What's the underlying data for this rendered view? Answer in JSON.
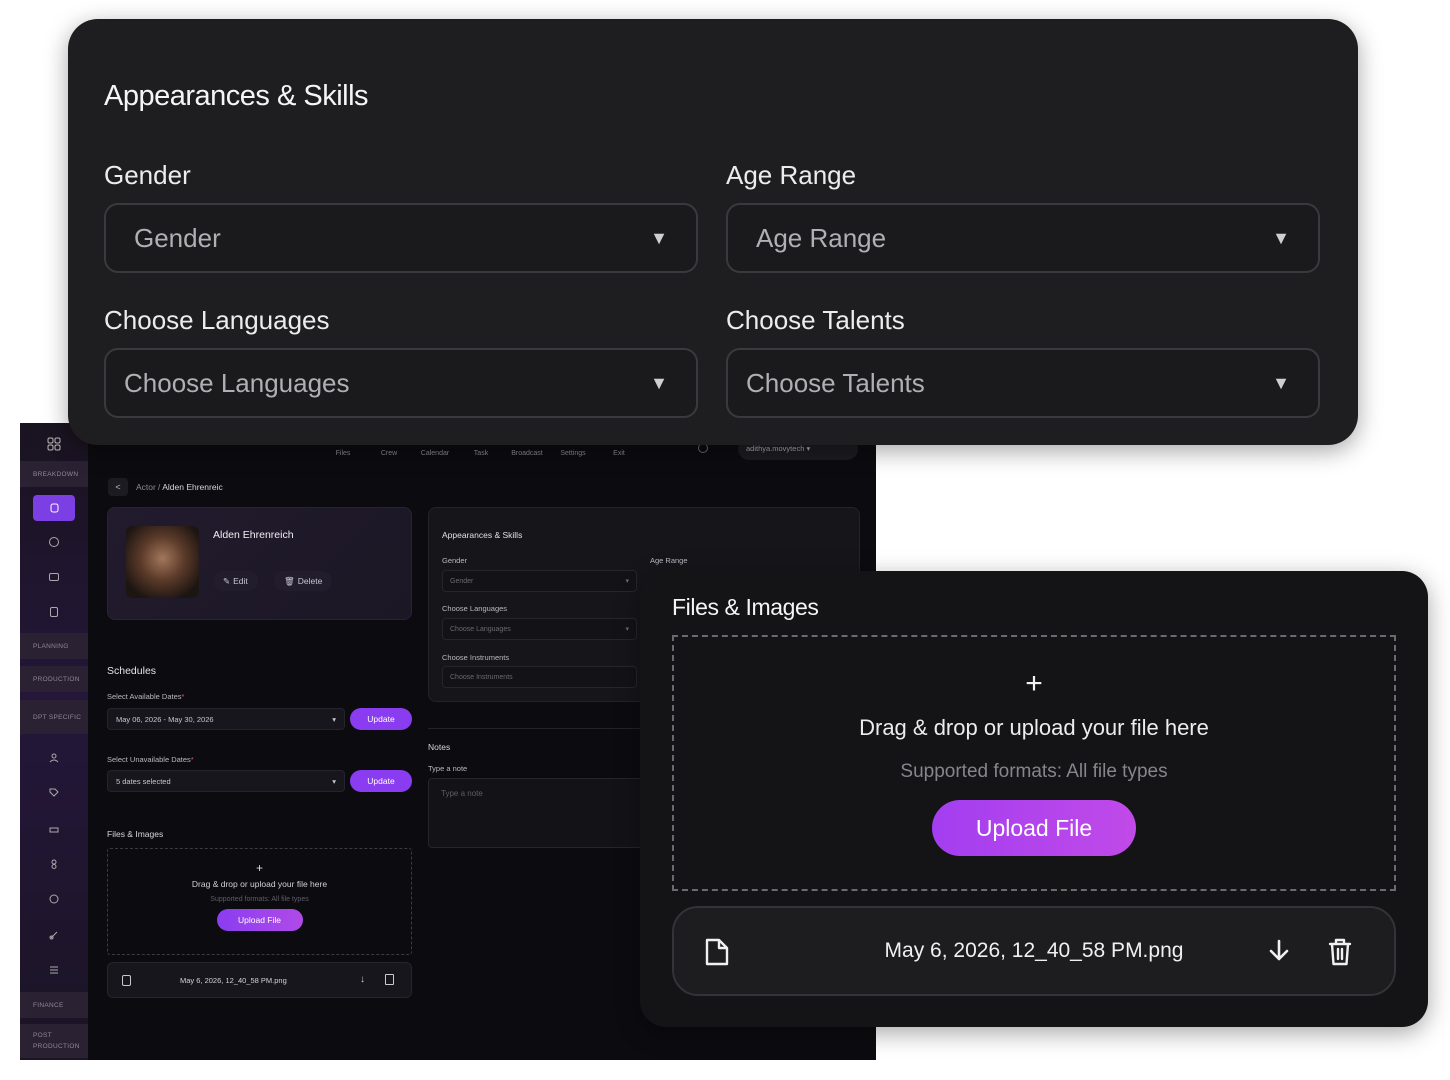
{
  "top_card": {
    "title": "Appearances & Skills",
    "gender": {
      "label": "Gender",
      "placeholder": "Gender"
    },
    "age_range": {
      "label": "Age Range",
      "placeholder": "Age Range"
    },
    "languages": {
      "label": "Choose Languages",
      "placeholder": "Choose Languages"
    },
    "talents": {
      "label": "Choose Talents",
      "placeholder": "Choose Talents"
    },
    "arrow": "▼"
  },
  "files_card": {
    "title": "Files & Images",
    "plus": "+",
    "drop_text": "Drag & drop or upload your file here",
    "formats": "Supported formats: All file types",
    "upload_label": "Upload File",
    "file_name": "May 6, 2026, 12_40_58 PM.png"
  },
  "app": {
    "rail_sections": [
      "BREAKDOWN",
      "PLANNING",
      "PRODUCTION",
      "DPT SPECIFIC",
      "FINANCE",
      "POST PRODUCTION"
    ],
    "topnav": [
      "Files",
      "Crew",
      "Calendar",
      "Task",
      "Broadcast",
      "Settings",
      "Exit"
    ],
    "user": "adithya.movytech ▾",
    "breadcrumb_parent": "Actor",
    "breadcrumb_sep": "/",
    "breadcrumb_current": "Alden Ehrenreic",
    "profile_name": "Alden Ehrenreich",
    "edit_label": "Edit",
    "delete_label": "Delete",
    "schedules_title": "Schedules",
    "available_label": "Select Available Dates",
    "available_value": "May 06, 2026 - May 30, 2026",
    "unavailable_label": "Select Unavailable Dates",
    "unavailable_value": "5 dates selected",
    "update_label": "Update",
    "req": "*",
    "files_label": "Files & Images",
    "drop_text": "Drag & drop or upload your file here",
    "formats": "Supported formats: All file types",
    "upload_label": "Upload File",
    "file_name": "May 6, 2026, 12_40_58 PM.png",
    "skills_title": "Appearances & Skills",
    "gender_label": "Gender",
    "gender_ph": "Gender",
    "age_label": "Age Range",
    "languages_label": "Choose Languages",
    "languages_ph": "Choose Languages",
    "instruments_label": "Choose Instruments",
    "instruments_ph": "Choose Instruments",
    "notes_title": "Notes",
    "note_label": "Type a note",
    "note_placeholder": "Type a note",
    "arrow": "▾"
  }
}
